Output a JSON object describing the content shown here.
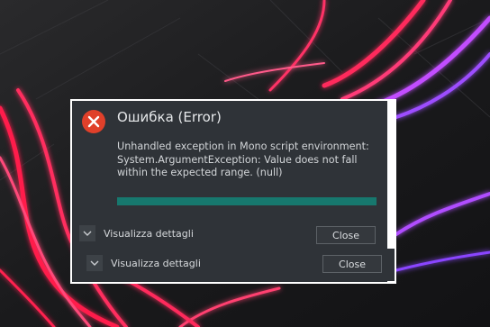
{
  "dialog": {
    "title": "Ошибка (Error)",
    "message": "Unhandled exception in Mono script environment: System.ArgumentException: Value does not fall within the expected range. (null)",
    "progress": 1.0,
    "icon": "error-circle-x-icon",
    "accent_color": "#17786e",
    "error_color": "#e0402a"
  },
  "details_rows": [
    {
      "details_label": "Visualizza dettagli",
      "close_label": "Close"
    },
    {
      "details_label": "Visualizza dettagli",
      "close_label": "Close"
    }
  ]
}
